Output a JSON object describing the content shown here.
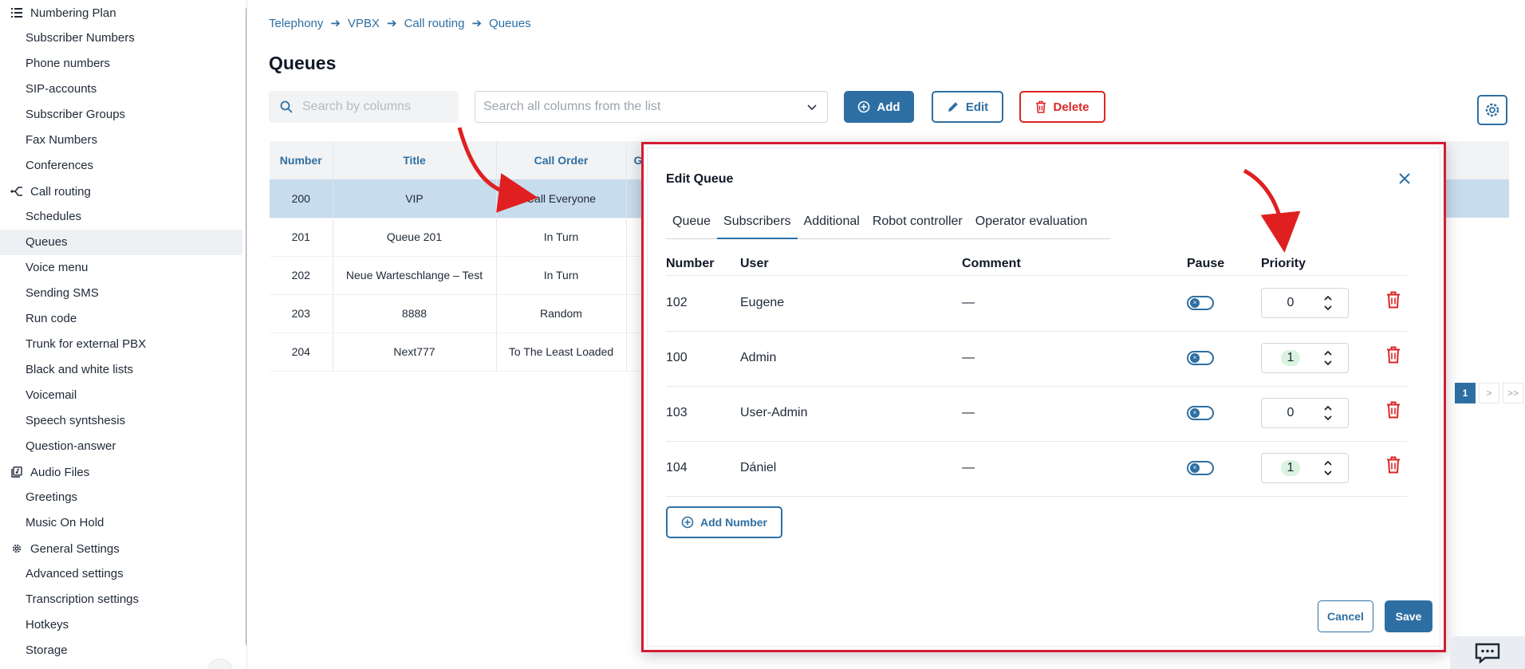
{
  "sidebar": {
    "groups": [
      {
        "label": "Numbering Plan",
        "icon": "list-icon",
        "items": [
          "Subscriber Numbers",
          "Phone numbers",
          "SIP-accounts",
          "Subscriber Groups",
          "Fax Numbers",
          "Conferences"
        ]
      },
      {
        "label": "Call routing",
        "icon": "routing-icon",
        "items": [
          "Schedules",
          "Queues",
          "Voice menu",
          "Sending SMS",
          "Run code",
          "Trunk for external PBX",
          "Black and white lists",
          "Voicemail",
          "Speech syntshesis",
          "Question-answer"
        ]
      },
      {
        "label": "Audio Files",
        "icon": "audio-files-icon",
        "items": [
          "Greetings",
          "Music On Hold"
        ]
      },
      {
        "label": "General Settings",
        "icon": "gear-icon",
        "items": [
          "Advanced settings",
          "Transcription settings",
          "Hotkeys",
          "Storage"
        ]
      }
    ],
    "active_item": "Queues"
  },
  "breadcrumb": [
    "Telephony",
    "VPBX",
    "Call routing",
    "Queues"
  ],
  "page_title": "Queues",
  "toolbar": {
    "search_placeholder": "Search by columns",
    "select_placeholder": "Search all columns from the list",
    "add_label": "Add",
    "edit_label": "Edit",
    "delete_label": "Delete"
  },
  "table": {
    "headers": [
      "Number",
      "Title",
      "Call Order",
      "G"
    ],
    "rows": [
      {
        "number": "200",
        "title": "VIP",
        "order": "Call Everyone"
      },
      {
        "number": "201",
        "title": "Queue 201",
        "order": "In Turn"
      },
      {
        "number": "202",
        "title": "Neue Warteschlange – Test",
        "order": "In Turn"
      },
      {
        "number": "203",
        "title": "8888",
        "order": "Random"
      },
      {
        "number": "204",
        "title": "Next777",
        "order": "To The Least Loaded"
      }
    ],
    "selected_row": 0
  },
  "pager": {
    "current": "1",
    "next": ">",
    "last": ">>"
  },
  "modal": {
    "title": "Edit Queue",
    "tabs": [
      "Queue",
      "Subscribers",
      "Additional",
      "Robot controller",
      "Operator evaluation"
    ],
    "active_tab": "Subscribers",
    "columns": {
      "number": "Number",
      "user": "User",
      "comment": "Comment",
      "pause": "Pause",
      "priority": "Priority"
    },
    "subscribers": [
      {
        "number": "102",
        "user": "Eugene",
        "comment": "—",
        "priority": "0",
        "highlight": false
      },
      {
        "number": "100",
        "user": "Admin",
        "comment": "—",
        "priority": "1",
        "highlight": true
      },
      {
        "number": "103",
        "user": "User-Admin",
        "comment": "—",
        "priority": "0",
        "highlight": false
      },
      {
        "number": "104",
        "user": "Dániel",
        "comment": "—",
        "priority": "1",
        "highlight": true
      }
    ],
    "add_number_label": "Add Number",
    "cancel_label": "Cancel",
    "save_label": "Save"
  },
  "colors": {
    "accent": "#2e6fa3",
    "danger": "#dc2626",
    "frame": "#d41c34",
    "arrow": "#e02020"
  }
}
